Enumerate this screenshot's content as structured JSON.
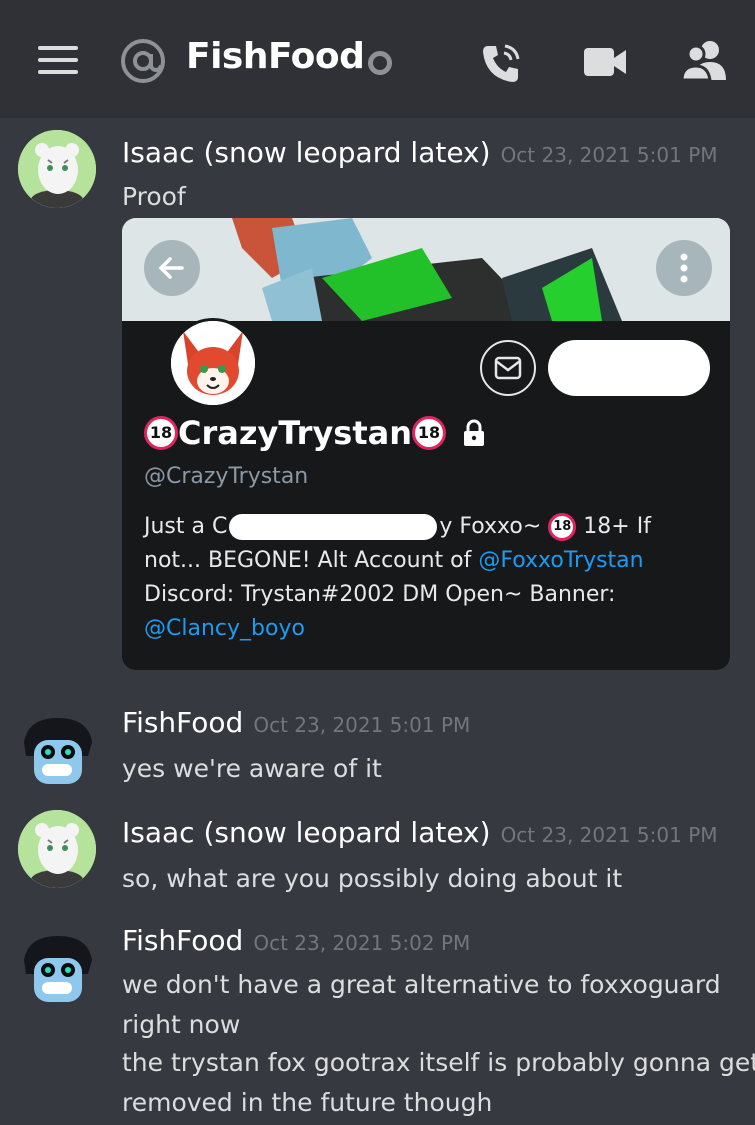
{
  "header": {
    "channel_title": "FishFood",
    "icons": [
      "menu-icon",
      "at-icon",
      "status-offline-icon",
      "call-icon",
      "video-icon",
      "members-icon"
    ]
  },
  "messages": [
    {
      "author": "Isaac (snow leopard latex)",
      "timestamp": "Oct 23, 2021 5:01 PM",
      "lines": [
        "Proof"
      ],
      "embed": {
        "display_name": "CrazyTrystan",
        "age_badge": "18",
        "handle": "@CrazyTrystan",
        "bio": {
          "line1_prefix": "Just a C",
          "line1_suffix": "y Foxxo~",
          "line1_after_badge": "18+ If",
          "line2_prefix": "not... BEGONE!  Alt Account of",
          "line2_link": "@FoxxoTrystan",
          "line3": "Discord: Trystan#2002 DM Open~  Banner:",
          "line4_link": "@Clancy_boyo"
        }
      }
    },
    {
      "author": "FishFood",
      "timestamp": "Oct 23, 2021 5:01 PM",
      "lines": [
        "yes we're aware of it"
      ]
    },
    {
      "author": "Isaac (snow leopard latex)",
      "timestamp": "Oct 23, 2021 5:01 PM",
      "lines": [
        "so, what are you possibly doing about it"
      ]
    },
    {
      "author": "FishFood",
      "timestamp": "Oct 23, 2021 5:02 PM",
      "lines": [
        "we don't have a great alternative to foxxoguard",
        "right now",
        "the trystan fox gootrax itself is probably gonna get",
        "removed in the future though"
      ]
    }
  ],
  "colors": {
    "background": "#36393f",
    "header": "#2f3136",
    "link": "#1d9bf0",
    "badge_red": "#e0245e"
  }
}
